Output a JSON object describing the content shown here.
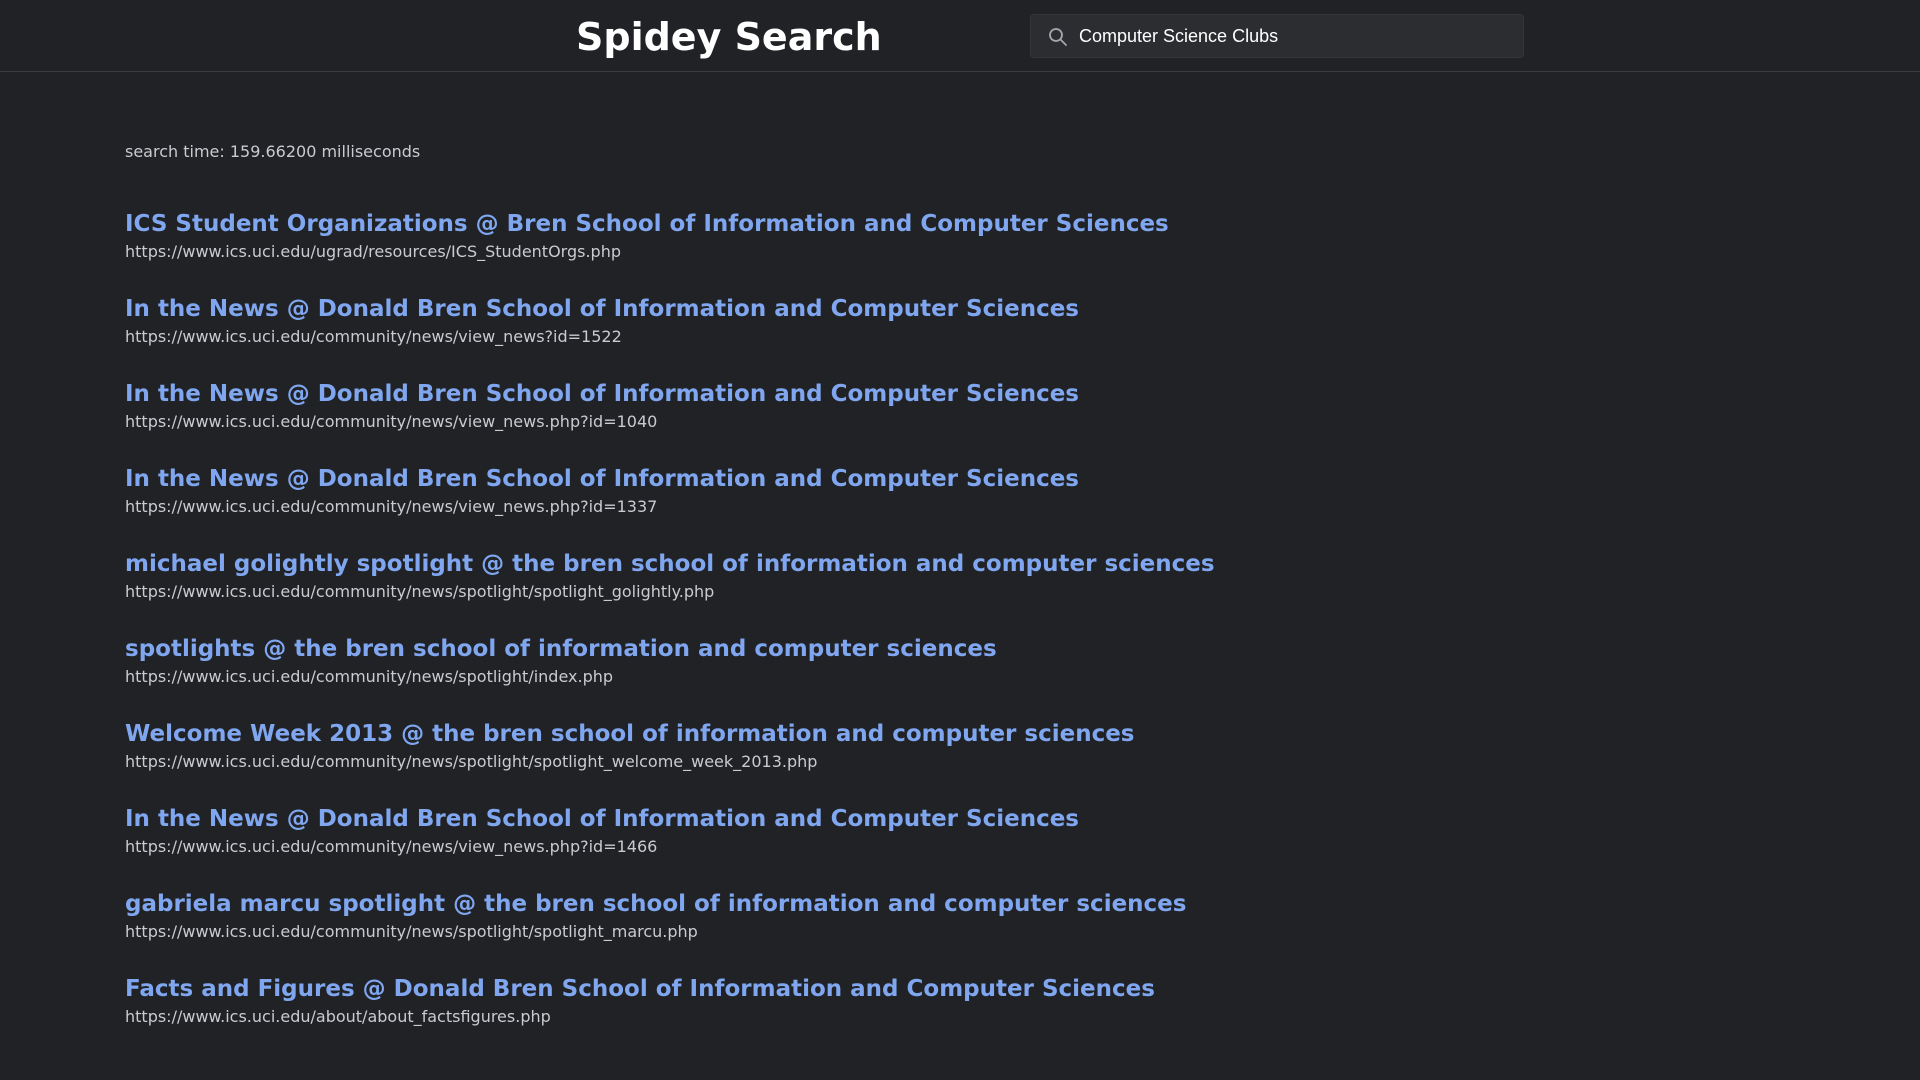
{
  "header": {
    "title": "Spidey Search"
  },
  "search": {
    "icon": "search-icon",
    "value": "Computer Science Clubs",
    "placeholder": ""
  },
  "search_time": "search time: 159.66200 milliseconds",
  "results": [
    {
      "title": "ICS Student Organizations @ Bren School of Information and Computer Sciences",
      "url": "https://www.ics.uci.edu/ugrad/resources/ICS_StudentOrgs.php"
    },
    {
      "title": "In the News @ Donald Bren School of Information and Computer Sciences",
      "url": "https://www.ics.uci.edu/community/news/view_news?id=1522"
    },
    {
      "title": "In the News @ Donald Bren School of Information and Computer Sciences",
      "url": "https://www.ics.uci.edu/community/news/view_news.php?id=1040"
    },
    {
      "title": "In the News @ Donald Bren School of Information and Computer Sciences",
      "url": "https://www.ics.uci.edu/community/news/view_news.php?id=1337"
    },
    {
      "title": "michael golightly spotlight @ the bren school of information and computer sciences",
      "url": "https://www.ics.uci.edu/community/news/spotlight/spotlight_golightly.php"
    },
    {
      "title": "spotlights @ the bren school of information and computer sciences",
      "url": "https://www.ics.uci.edu/community/news/spotlight/index.php"
    },
    {
      "title": "Welcome Week 2013 @ the bren school of information and computer sciences",
      "url": "https://www.ics.uci.edu/community/news/spotlight/spotlight_welcome_week_2013.php"
    },
    {
      "title": "In the News @ Donald Bren School of Information and Computer Sciences",
      "url": "https://www.ics.uci.edu/community/news/view_news.php?id=1466"
    },
    {
      "title": "gabriela marcu spotlight @ the bren school of information and computer sciences",
      "url": "https://www.ics.uci.edu/community/news/spotlight/spotlight_marcu.php"
    },
    {
      "title": "Facts and Figures @ Donald Bren School of Information and Computer Sciences",
      "url": "https://www.ics.uci.edu/about/about_factsfigures.php"
    }
  ],
  "colors": {
    "background": "#202226",
    "title_link": "#7fa6ef",
    "url_text": "#c9cbd0",
    "heading": "#ffffff"
  }
}
